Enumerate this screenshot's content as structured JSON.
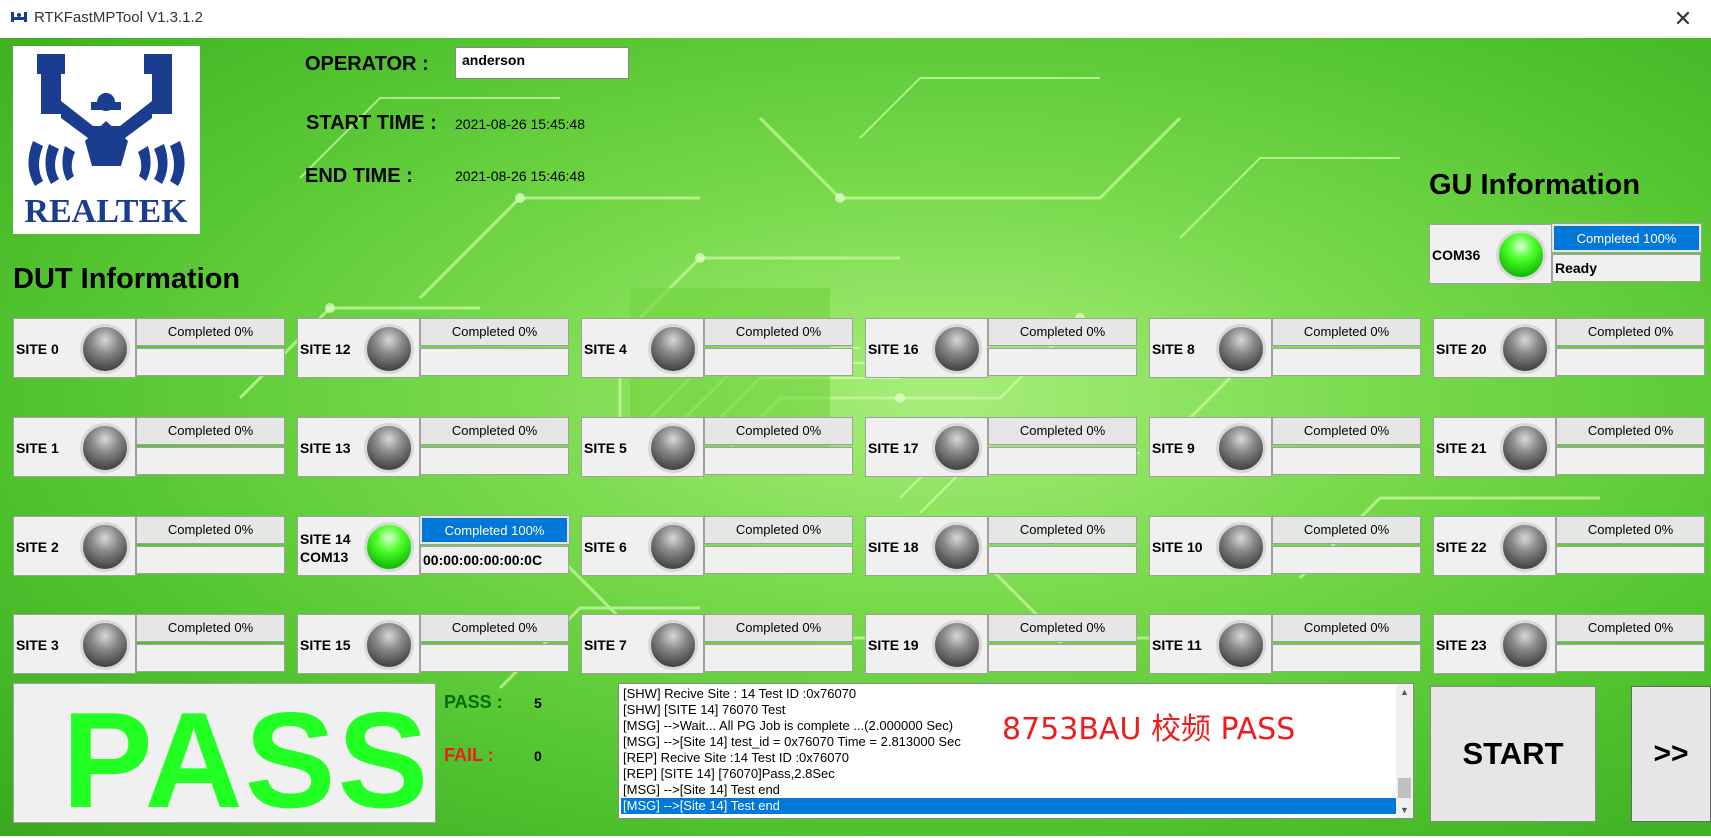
{
  "window": {
    "title": "RTKFastMPTool V1.3.1.2",
    "close_glyph": "✕"
  },
  "header": {
    "operator_label": "OPERATOR :",
    "operator_value": "anderson",
    "start_label": "START TIME :",
    "start_value": "2021-08-26 15:45:48",
    "end_label": "END TIME :",
    "end_value": "2021-08-26 15:46:48"
  },
  "logo": {
    "text": "REALTEK",
    "icon": "realtek-crab-logo"
  },
  "gu": {
    "title": "GU Information",
    "port": "COM36",
    "status": "green",
    "progress": "Completed 100%",
    "progress_value": 100,
    "state": "Ready"
  },
  "dut": {
    "title": "DUT Information",
    "sites": [
      {
        "name": "SITE 0",
        "progress": "Completed 0%",
        "led": "grey",
        "info": ""
      },
      {
        "name": "SITE 12",
        "progress": "Completed 0%",
        "led": "grey",
        "info": ""
      },
      {
        "name": "SITE 4",
        "progress": "Completed 0%",
        "led": "grey",
        "info": ""
      },
      {
        "name": "SITE 16",
        "progress": "Completed 0%",
        "led": "grey",
        "info": ""
      },
      {
        "name": "SITE 8",
        "progress": "Completed 0%",
        "led": "grey",
        "info": ""
      },
      {
        "name": "SITE 20",
        "progress": "Completed 0%",
        "led": "grey",
        "info": ""
      },
      {
        "name": "SITE 1",
        "progress": "Completed 0%",
        "led": "grey",
        "info": ""
      },
      {
        "name": "SITE 13",
        "progress": "Completed 0%",
        "led": "grey",
        "info": ""
      },
      {
        "name": "SITE 5",
        "progress": "Completed 0%",
        "led": "grey",
        "info": ""
      },
      {
        "name": "SITE 17",
        "progress": "Completed 0%",
        "led": "grey",
        "info": ""
      },
      {
        "name": "SITE 9",
        "progress": "Completed 0%",
        "led": "grey",
        "info": ""
      },
      {
        "name": "SITE 21",
        "progress": "Completed 0%",
        "led": "grey",
        "info": ""
      },
      {
        "name": "SITE 2",
        "progress": "Completed 0%",
        "led": "grey",
        "info": ""
      },
      {
        "name": "SITE 14",
        "port": "COM13",
        "progress": "Completed 100%",
        "led": "green",
        "info": "00:00:00:00:00:0C"
      },
      {
        "name": "SITE 6",
        "progress": "Completed 0%",
        "led": "grey",
        "info": ""
      },
      {
        "name": "SITE 18",
        "progress": "Completed 0%",
        "led": "grey",
        "info": ""
      },
      {
        "name": "SITE 10",
        "progress": "Completed 0%",
        "led": "grey",
        "info": ""
      },
      {
        "name": "SITE 22",
        "progress": "Completed 0%",
        "led": "grey",
        "info": ""
      },
      {
        "name": "SITE 3",
        "progress": "Completed 0%",
        "led": "grey",
        "info": ""
      },
      {
        "name": "SITE 15",
        "progress": "Completed 0%",
        "led": "grey",
        "info": ""
      },
      {
        "name": "SITE 7",
        "progress": "Completed 0%",
        "led": "grey",
        "info": ""
      },
      {
        "name": "SITE 19",
        "progress": "Completed 0%",
        "led": "grey",
        "info": ""
      },
      {
        "name": "SITE 11",
        "progress": "Completed 0%",
        "led": "grey",
        "info": ""
      },
      {
        "name": "SITE 23",
        "progress": "Completed 0%",
        "led": "grey",
        "info": ""
      }
    ]
  },
  "result": {
    "text": "PASS",
    "pass_label": "PASS :",
    "pass_count": "5",
    "fail_label": "FAIL :",
    "fail_count": "0"
  },
  "log": {
    "lines": [
      "[SHW] Recive Site : 14 Test ID :0x76070",
      "[SHW] [SITE 14] 76070 Test",
      "[MSG] -->Wait... All PG Job is complete ...(2.000000 Sec)",
      "[MSG] -->[Site 14] test_id = 0x76070  Time = 2.813000 Sec",
      "[REP] Recive Site :14 Test ID :0x76070",
      "[REP] [SITE 14] [76070]Pass,2.8Sec",
      "[MSG] -->[Site 14] Test end",
      "[MSG] -->[Site 14] Test end"
    ],
    "selected_index": 7
  },
  "annotation": "8753BAU 校频 PASS",
  "buttons": {
    "start": "START",
    "more": ">>"
  },
  "colors": {
    "progress_fill": "#0078d7",
    "pass_green": "#22ff22",
    "fail_red": "#ee1c1c",
    "pass_label": "#0a6a0a",
    "annotation": "#ee1c1c"
  }
}
